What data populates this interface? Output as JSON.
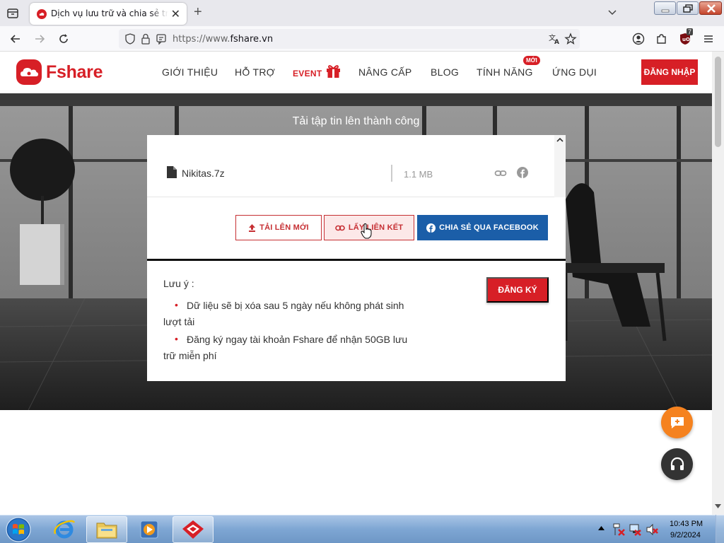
{
  "browser": {
    "tab_title": "Dịch vụ lưu trữ và chia sẻ trực tuyến",
    "url_prefix": "https://www.",
    "url_domain": "fshare.vn",
    "new_tab_glyph": "+",
    "close_glyph": "✕",
    "extension_badge": "7"
  },
  "site": {
    "logo_text": "Fshare",
    "menu": {
      "about": "GIỚI THIỆU",
      "support": "HỖ TRỢ",
      "event": "EVENT",
      "upgrade": "NÂNG CẤP",
      "blog": "BLOG",
      "features": "TÍNH NĂNG",
      "apps": "ỨNG DỤI"
    },
    "new_badge": "MỚI",
    "login_label": "ĐĂNG NHẬP"
  },
  "upload": {
    "title": "Tải tập tin lên thành công",
    "file_name": "Nikitas.7z",
    "file_size": "1.1 MB",
    "btn_upload_new": "TẢI LÊN MỚI",
    "btn_get_link": "LẤY LIÊN KẾT",
    "btn_share_fb": "CHIA SẺ QUA FACEBOOK"
  },
  "note": {
    "title": "Lưu ý :",
    "items": [
      "Dữ liệu sẽ bị xóa sau 5 ngày nếu không phát sinh lượt tải",
      "Đăng ký ngay tài khoản Fshare để nhận 50GB lưu trữ miễn phí"
    ],
    "register_label": "ĐĂNG KÝ"
  },
  "taskbar": {
    "time": "10:43 PM",
    "date": "9/2/2024"
  },
  "colors": {
    "brand_red": "#d71f26",
    "facebook_blue": "#1b5ea8",
    "chat_orange": "#f5821f"
  },
  "icons": [
    "tab-list-icon",
    "fshare-favicon",
    "back-icon",
    "forward-icon",
    "reload-icon",
    "shield-icon",
    "lock-icon",
    "permissions-icon",
    "translate-icon",
    "bookmark-star-icon",
    "account-icon",
    "extensions-icon",
    "ublock-icon",
    "menu-icon",
    "gift-icon",
    "file-icon",
    "link-icon",
    "facebook-icon",
    "upload-icon",
    "chat-icon",
    "headset-icon",
    "windows-start-icon",
    "ie-icon",
    "explorer-icon",
    "media-player-icon",
    "fshare-taskbar-icon"
  ]
}
